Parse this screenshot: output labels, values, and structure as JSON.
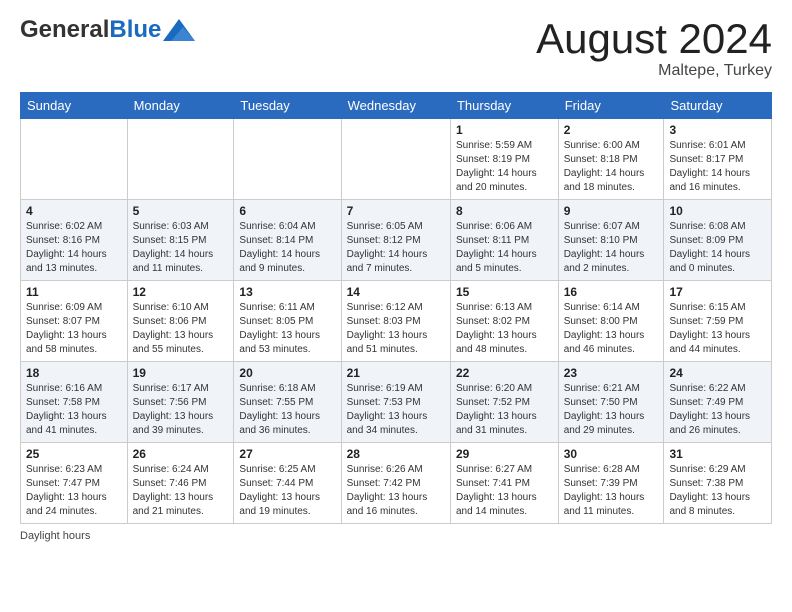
{
  "header": {
    "logo_general": "General",
    "logo_blue": "Blue",
    "title": "August 2024",
    "location": "Maltepe, Turkey"
  },
  "days_of_week": [
    "Sunday",
    "Monday",
    "Tuesday",
    "Wednesday",
    "Thursday",
    "Friday",
    "Saturday"
  ],
  "weeks": [
    [
      {
        "day": "",
        "info": ""
      },
      {
        "day": "",
        "info": ""
      },
      {
        "day": "",
        "info": ""
      },
      {
        "day": "",
        "info": ""
      },
      {
        "day": "1",
        "info": "Sunrise: 5:59 AM\nSunset: 8:19 PM\nDaylight: 14 hours and 20 minutes."
      },
      {
        "day": "2",
        "info": "Sunrise: 6:00 AM\nSunset: 8:18 PM\nDaylight: 14 hours and 18 minutes."
      },
      {
        "day": "3",
        "info": "Sunrise: 6:01 AM\nSunset: 8:17 PM\nDaylight: 14 hours and 16 minutes."
      }
    ],
    [
      {
        "day": "4",
        "info": "Sunrise: 6:02 AM\nSunset: 8:16 PM\nDaylight: 14 hours and 13 minutes."
      },
      {
        "day": "5",
        "info": "Sunrise: 6:03 AM\nSunset: 8:15 PM\nDaylight: 14 hours and 11 minutes."
      },
      {
        "day": "6",
        "info": "Sunrise: 6:04 AM\nSunset: 8:14 PM\nDaylight: 14 hours and 9 minutes."
      },
      {
        "day": "7",
        "info": "Sunrise: 6:05 AM\nSunset: 8:12 PM\nDaylight: 14 hours and 7 minutes."
      },
      {
        "day": "8",
        "info": "Sunrise: 6:06 AM\nSunset: 8:11 PM\nDaylight: 14 hours and 5 minutes."
      },
      {
        "day": "9",
        "info": "Sunrise: 6:07 AM\nSunset: 8:10 PM\nDaylight: 14 hours and 2 minutes."
      },
      {
        "day": "10",
        "info": "Sunrise: 6:08 AM\nSunset: 8:09 PM\nDaylight: 14 hours and 0 minutes."
      }
    ],
    [
      {
        "day": "11",
        "info": "Sunrise: 6:09 AM\nSunset: 8:07 PM\nDaylight: 13 hours and 58 minutes."
      },
      {
        "day": "12",
        "info": "Sunrise: 6:10 AM\nSunset: 8:06 PM\nDaylight: 13 hours and 55 minutes."
      },
      {
        "day": "13",
        "info": "Sunrise: 6:11 AM\nSunset: 8:05 PM\nDaylight: 13 hours and 53 minutes."
      },
      {
        "day": "14",
        "info": "Sunrise: 6:12 AM\nSunset: 8:03 PM\nDaylight: 13 hours and 51 minutes."
      },
      {
        "day": "15",
        "info": "Sunrise: 6:13 AM\nSunset: 8:02 PM\nDaylight: 13 hours and 48 minutes."
      },
      {
        "day": "16",
        "info": "Sunrise: 6:14 AM\nSunset: 8:00 PM\nDaylight: 13 hours and 46 minutes."
      },
      {
        "day": "17",
        "info": "Sunrise: 6:15 AM\nSunset: 7:59 PM\nDaylight: 13 hours and 44 minutes."
      }
    ],
    [
      {
        "day": "18",
        "info": "Sunrise: 6:16 AM\nSunset: 7:58 PM\nDaylight: 13 hours and 41 minutes."
      },
      {
        "day": "19",
        "info": "Sunrise: 6:17 AM\nSunset: 7:56 PM\nDaylight: 13 hours and 39 minutes."
      },
      {
        "day": "20",
        "info": "Sunrise: 6:18 AM\nSunset: 7:55 PM\nDaylight: 13 hours and 36 minutes."
      },
      {
        "day": "21",
        "info": "Sunrise: 6:19 AM\nSunset: 7:53 PM\nDaylight: 13 hours and 34 minutes."
      },
      {
        "day": "22",
        "info": "Sunrise: 6:20 AM\nSunset: 7:52 PM\nDaylight: 13 hours and 31 minutes."
      },
      {
        "day": "23",
        "info": "Sunrise: 6:21 AM\nSunset: 7:50 PM\nDaylight: 13 hours and 29 minutes."
      },
      {
        "day": "24",
        "info": "Sunrise: 6:22 AM\nSunset: 7:49 PM\nDaylight: 13 hours and 26 minutes."
      }
    ],
    [
      {
        "day": "25",
        "info": "Sunrise: 6:23 AM\nSunset: 7:47 PM\nDaylight: 13 hours and 24 minutes."
      },
      {
        "day": "26",
        "info": "Sunrise: 6:24 AM\nSunset: 7:46 PM\nDaylight: 13 hours and 21 minutes."
      },
      {
        "day": "27",
        "info": "Sunrise: 6:25 AM\nSunset: 7:44 PM\nDaylight: 13 hours and 19 minutes."
      },
      {
        "day": "28",
        "info": "Sunrise: 6:26 AM\nSunset: 7:42 PM\nDaylight: 13 hours and 16 minutes."
      },
      {
        "day": "29",
        "info": "Sunrise: 6:27 AM\nSunset: 7:41 PM\nDaylight: 13 hours and 14 minutes."
      },
      {
        "day": "30",
        "info": "Sunrise: 6:28 AM\nSunset: 7:39 PM\nDaylight: 13 hours and 11 minutes."
      },
      {
        "day": "31",
        "info": "Sunrise: 6:29 AM\nSunset: 7:38 PM\nDaylight: 13 hours and 8 minutes."
      }
    ]
  ],
  "legend": {
    "daylight_label": "Daylight hours"
  }
}
